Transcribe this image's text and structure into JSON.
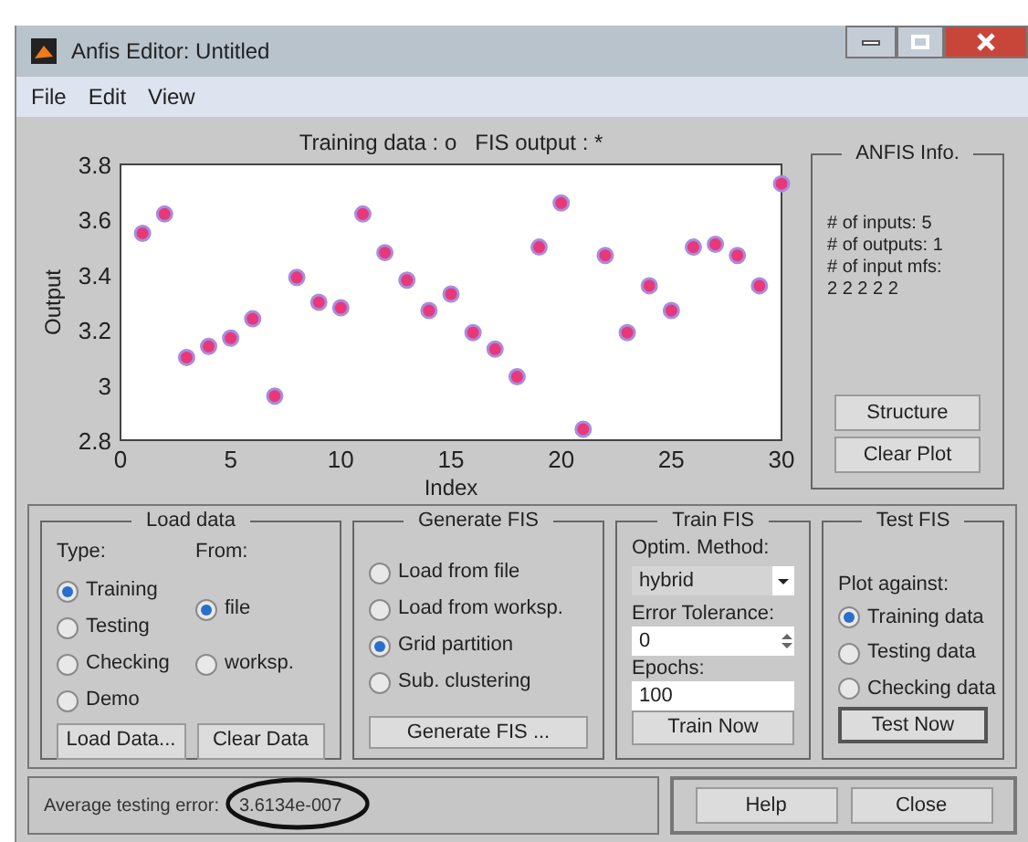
{
  "window": {
    "title": "Anfis Editor: Untitled"
  },
  "menu": [
    "File",
    "Edit",
    "View"
  ],
  "plot": {
    "chart_data": {
      "type": "scatter",
      "title": "Training data : o   FIS output : *",
      "xlabel": "Index",
      "ylabel": "Output",
      "x": [
        1,
        2,
        3,
        4,
        5,
        6,
        7,
        8,
        9,
        10,
        11,
        12,
        13,
        14,
        15,
        16,
        17,
        18,
        19,
        20,
        21,
        22,
        23,
        24,
        25,
        26,
        27,
        28,
        29,
        30
      ],
      "series": [
        {
          "color": "#e8387a",
          "values": [
            3.55,
            3.62,
            3.1,
            3.14,
            3.17,
            3.24,
            2.96,
            3.39,
            3.3,
            3.28,
            3.62,
            3.48,
            3.38,
            3.27,
            3.33,
            3.19,
            3.13,
            3.03,
            3.5,
            3.66,
            2.84,
            3.47,
            3.19,
            3.36,
            3.27,
            3.5,
            3.51,
            3.47,
            3.36,
            3.73
          ]
        }
      ],
      "xlim": [
        0,
        30
      ],
      "ylim": [
        2.8,
        3.8
      ],
      "xticks": [
        0,
        5,
        10,
        15,
        20,
        25,
        30
      ],
      "yticks": [
        2.8,
        3,
        3.2,
        3.4,
        3.6,
        3.8
      ]
    }
  },
  "anfis_info": {
    "title": "ANFIS Info.",
    "lines": [
      "# of inputs: 5",
      "# of outputs: 1",
      "# of input mfs:",
      "2 2 2 2 2"
    ],
    "buttons": [
      "Structure",
      "Clear Plot"
    ]
  },
  "load_data": {
    "title": "Load data",
    "type_label": "Type:",
    "from_label": "From:",
    "types": [
      {
        "label": "Training",
        "selected": true
      },
      {
        "label": "Testing",
        "selected": false
      },
      {
        "label": "Checking",
        "selected": false
      },
      {
        "label": "Demo",
        "selected": false
      }
    ],
    "sources": [
      {
        "label": "file",
        "selected": true
      },
      {
        "label": "worksp.",
        "selected": false
      }
    ],
    "buttons": [
      "Load Data...",
      "Clear Data"
    ]
  },
  "generate_fis": {
    "title": "Generate FIS",
    "options": [
      {
        "label": "Load from file",
        "selected": false
      },
      {
        "label": "Load from worksp.",
        "selected": false
      },
      {
        "label": "Grid partition",
        "selected": true
      },
      {
        "label": "Sub. clustering",
        "selected": false
      }
    ],
    "button": "Generate FIS ..."
  },
  "train_fis": {
    "title": "Train FIS",
    "method_label": "Optim. Method:",
    "method": "hybrid",
    "tolerance_label": "Error Tolerance:",
    "tolerance": "0",
    "epochs_label": "Epochs:",
    "epochs": "100",
    "button": "Train Now"
  },
  "test_fis": {
    "title": "Test FIS",
    "plot_label": "Plot against:",
    "options": [
      {
        "label": "Training data",
        "selected": true
      },
      {
        "label": "Testing data",
        "selected": false
      },
      {
        "label": "Checking data",
        "selected": false
      }
    ],
    "button": "Test Now"
  },
  "status": {
    "label": "Average testing error:",
    "value": "3.6134e-007"
  },
  "buttons": [
    "Help",
    "Close"
  ]
}
